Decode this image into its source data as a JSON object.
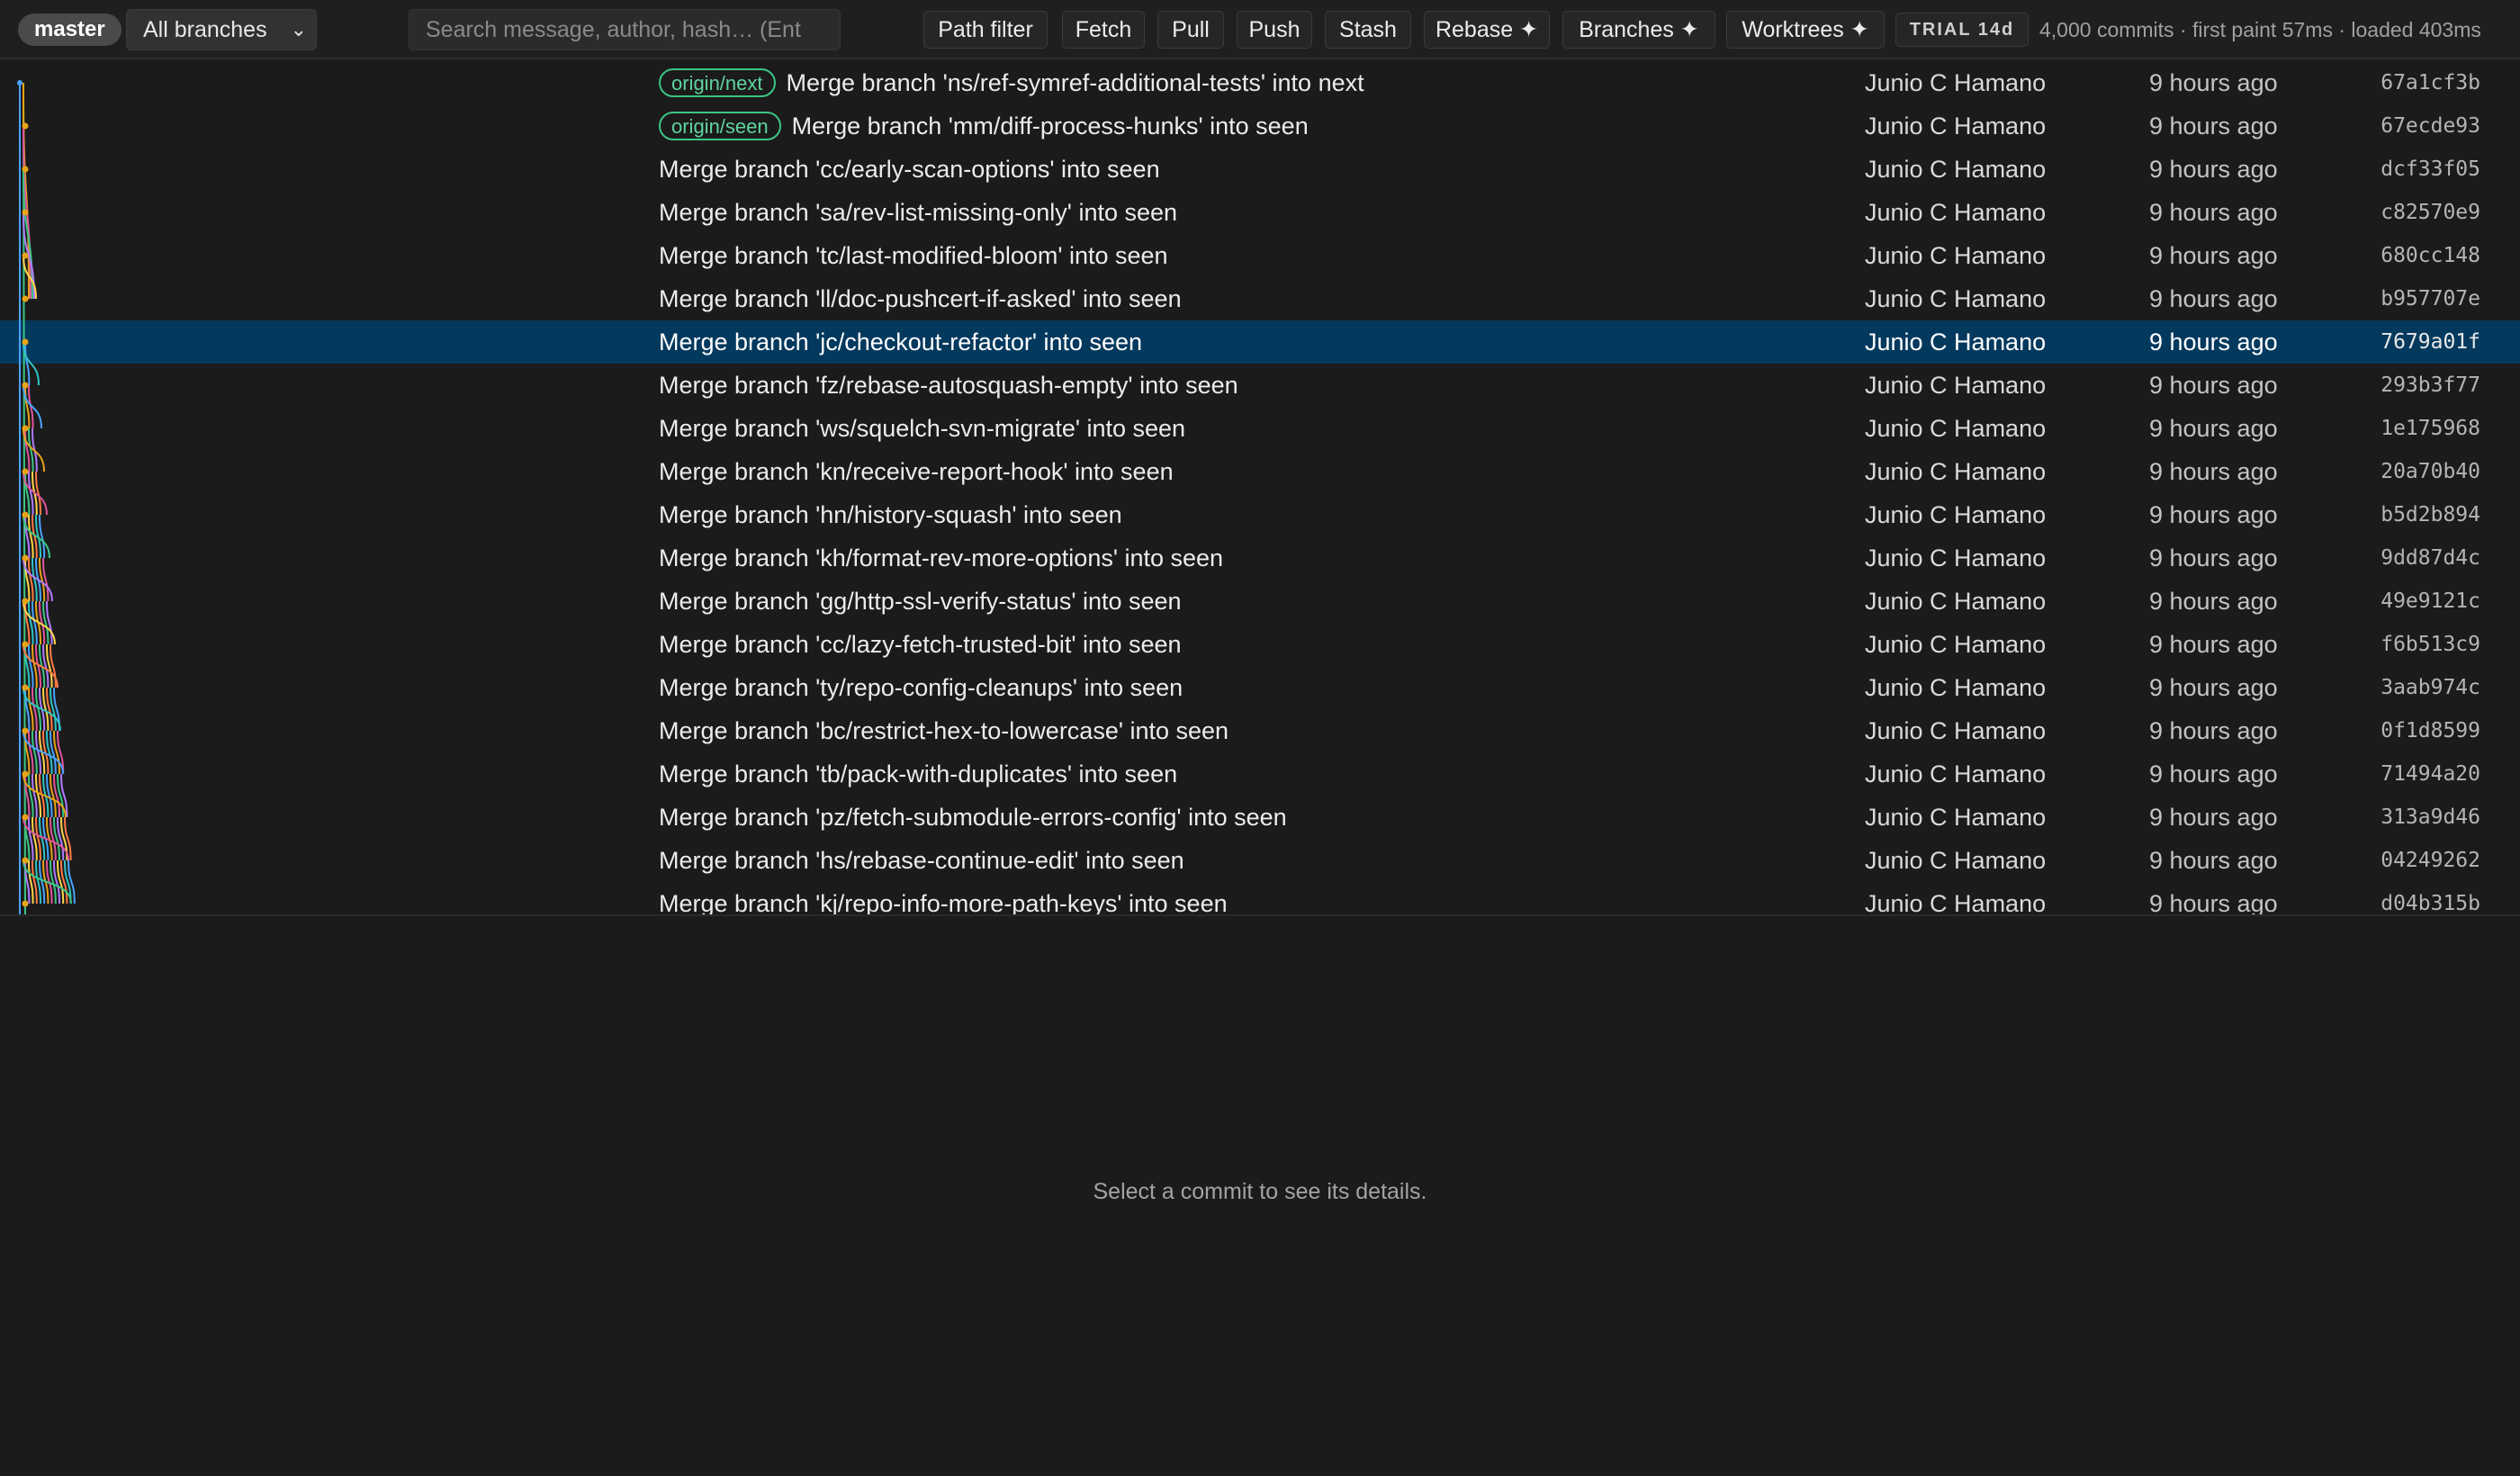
{
  "toolbar": {
    "current_branch": "master",
    "branch_filter": "All branches",
    "search_placeholder": "Search message, author, hash… (Ent",
    "buttons": {
      "path_filter": "Path filter",
      "fetch": "Fetch",
      "pull": "Pull",
      "push": "Push",
      "stash": "Stash",
      "rebase": "Rebase ✦",
      "branches": "Branches ✦",
      "worktrees": "Worktrees ✦"
    },
    "trial_badge": "TRIAL 14d",
    "stats": "4,000 commits · first paint 57ms · loaded 403ms"
  },
  "commits": [
    {
      "ref": "origin/next",
      "message": "Merge branch 'ns/ref-symref-additional-tests' into next",
      "author": "Junio C Hamano",
      "date": "9 hours ago",
      "hash": "67a1cf3b"
    },
    {
      "ref": "origin/seen",
      "message": "Merge branch 'mm/diff-process-hunks' into seen",
      "author": "Junio C Hamano",
      "date": "9 hours ago",
      "hash": "67ecde93"
    },
    {
      "ref": "",
      "message": "Merge branch 'cc/early-scan-options' into seen",
      "author": "Junio C Hamano",
      "date": "9 hours ago",
      "hash": "dcf33f05"
    },
    {
      "ref": "",
      "message": "Merge branch 'sa/rev-list-missing-only' into seen",
      "author": "Junio C Hamano",
      "date": "9 hours ago",
      "hash": "c82570e9"
    },
    {
      "ref": "",
      "message": "Merge branch 'tc/last-modified-bloom' into seen",
      "author": "Junio C Hamano",
      "date": "9 hours ago",
      "hash": "680cc148"
    },
    {
      "ref": "",
      "message": "Merge branch 'll/doc-pushcert-if-asked' into seen",
      "author": "Junio C Hamano",
      "date": "9 hours ago",
      "hash": "b957707e"
    },
    {
      "ref": "",
      "message": "Merge branch 'jc/checkout-refactor' into seen",
      "author": "Junio C Hamano",
      "date": "9 hours ago",
      "hash": "7679a01f",
      "selected": true
    },
    {
      "ref": "",
      "message": "Merge branch 'fz/rebase-autosquash-empty' into seen",
      "author": "Junio C Hamano",
      "date": "9 hours ago",
      "hash": "293b3f77"
    },
    {
      "ref": "",
      "message": "Merge branch 'ws/squelch-svn-migrate' into seen",
      "author": "Junio C Hamano",
      "date": "9 hours ago",
      "hash": "1e175968"
    },
    {
      "ref": "",
      "message": "Merge branch 'kn/receive-report-hook' into seen",
      "author": "Junio C Hamano",
      "date": "9 hours ago",
      "hash": "20a70b40"
    },
    {
      "ref": "",
      "message": "Merge branch 'hn/history-squash' into seen",
      "author": "Junio C Hamano",
      "date": "9 hours ago",
      "hash": "b5d2b894"
    },
    {
      "ref": "",
      "message": "Merge branch 'kh/format-rev-more-options' into seen",
      "author": "Junio C Hamano",
      "date": "9 hours ago",
      "hash": "9dd87d4c"
    },
    {
      "ref": "",
      "message": "Merge branch 'gg/http-ssl-verify-status' into seen",
      "author": "Junio C Hamano",
      "date": "9 hours ago",
      "hash": "49e9121c"
    },
    {
      "ref": "",
      "message": "Merge branch 'cc/lazy-fetch-trusted-bit' into seen",
      "author": "Junio C Hamano",
      "date": "9 hours ago",
      "hash": "f6b513c9"
    },
    {
      "ref": "",
      "message": "Merge branch 'ty/repo-config-cleanups' into seen",
      "author": "Junio C Hamano",
      "date": "9 hours ago",
      "hash": "3aab974c"
    },
    {
      "ref": "",
      "message": "Merge branch 'bc/restrict-hex-to-lowercase' into seen",
      "author": "Junio C Hamano",
      "date": "9 hours ago",
      "hash": "0f1d8599"
    },
    {
      "ref": "",
      "message": "Merge branch 'tb/pack-with-duplicates' into seen",
      "author": "Junio C Hamano",
      "date": "9 hours ago",
      "hash": "71494a20"
    },
    {
      "ref": "",
      "message": "Merge branch 'pz/fetch-submodule-errors-config' into seen",
      "author": "Junio C Hamano",
      "date": "9 hours ago",
      "hash": "313a9d46"
    },
    {
      "ref": "",
      "message": "Merge branch 'hs/rebase-continue-edit' into seen",
      "author": "Junio C Hamano",
      "date": "9 hours ago",
      "hash": "04249262"
    },
    {
      "ref": "",
      "message": "Merge branch 'kj/repo-info-more-path-keys' into seen",
      "author": "Junio C Hamano",
      "date": "9 hours ago",
      "hash": "d04b315b"
    }
  ],
  "detail_placeholder": "Select a commit to see its details.",
  "colors": {
    "selection": "#04395e",
    "ref_badge": "#3cc585",
    "commit_dot": "#e8a317",
    "graph_lanes": [
      "#4aa3ff",
      "#e8a317",
      "#e0559b",
      "#3cc585",
      "#b07cff",
      "#ffd54a",
      "#ff7a45",
      "#2fc4c4"
    ]
  }
}
